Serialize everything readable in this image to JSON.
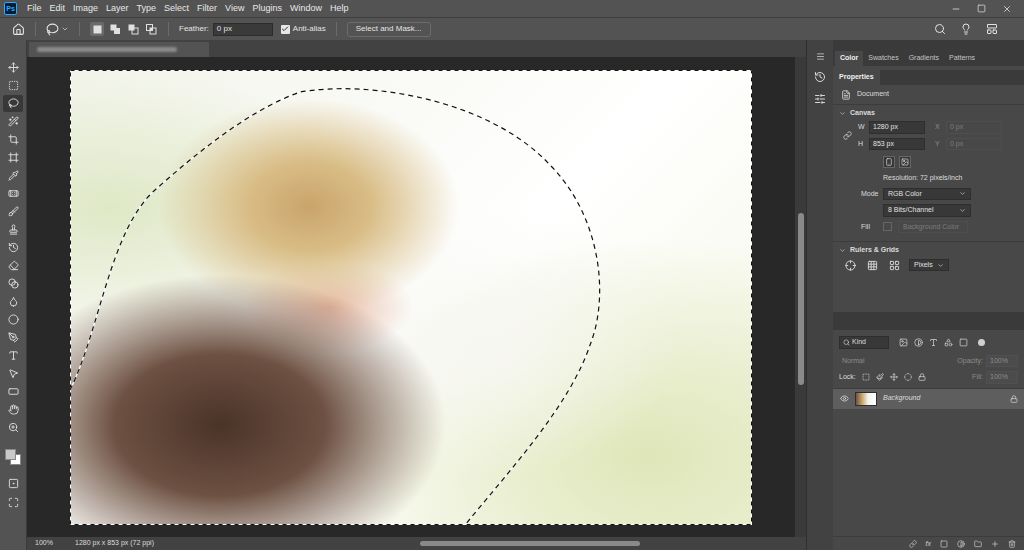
{
  "app": {
    "logo": "Ps"
  },
  "menu": [
    "File",
    "Edit",
    "Image",
    "Layer",
    "Type",
    "Select",
    "Filter",
    "View",
    "Plugins",
    "Window",
    "Help"
  ],
  "options_bar": {
    "feather_label": "Feather:",
    "feather_value": "0 px",
    "anti_alias": {
      "label": "Anti-alias",
      "checked": true
    },
    "select_and_mask": "Select and Mask...",
    "modes": [
      {
        "selected": true
      },
      {
        "selected": false
      },
      {
        "selected": false
      },
      {
        "selected": false
      }
    ]
  },
  "tools": [
    {
      "selected": false
    },
    {
      "selected": false
    },
    {
      "selected": true
    },
    {
      "selected": false
    },
    {
      "selected": false
    },
    {
      "selected": false
    },
    {
      "selected": false
    },
    {
      "selected": false
    },
    {
      "selected": false
    },
    {
      "selected": false
    },
    {
      "selected": false
    },
    {
      "selected": false
    },
    {
      "selected": false
    },
    {
      "selected": false
    },
    {
      "selected": false
    },
    {
      "selected": false
    },
    {
      "selected": false
    },
    {
      "selected": false
    },
    {
      "selected": false
    },
    {
      "selected": false
    },
    {
      "selected": false
    }
  ],
  "panel_tabs": [
    {
      "label": "Color",
      "selected": true
    },
    {
      "label": "Swatches",
      "selected": false
    },
    {
      "label": "Gradients",
      "selected": false
    },
    {
      "label": "Patterns",
      "selected": false
    }
  ],
  "properties": {
    "tab": "Properties",
    "target": "Document",
    "canvas": {
      "title": "Canvas",
      "fields": [
        {
          "label": "W",
          "value": "1280 px",
          "disabled": false
        },
        {
          "label": "X",
          "value": "0 px",
          "disabled": true
        },
        {
          "label": "H",
          "value": "853 px",
          "disabled": false
        },
        {
          "label": "Y",
          "value": "0 px",
          "disabled": true
        }
      ],
      "resolution": "Resolution: 72 pixels/inch",
      "mode_label": "Mode",
      "mode": "RGB Color",
      "depth": "8 Bits/Channel",
      "fill_label": "Fill",
      "fill": "Background Color",
      "fill_disabled": true
    },
    "rulers": {
      "title": "Rulers & Grids",
      "unit": "Pixels"
    }
  },
  "layers": {
    "filter": "Kind",
    "blend_mode": "Normal",
    "opacity_label": "Opacity:",
    "opacity": "100%",
    "lock_label": "Lock:",
    "fill_label": "Fill:",
    "fill": "100%",
    "controls_disabled": true,
    "items": [
      {
        "name": "Background",
        "visible": true,
        "locked": true,
        "selected": true
      }
    ],
    "footer": {
      "fx": "fx"
    }
  },
  "status_bar": {
    "zoom": "100%",
    "info": "1280 px x 853 px (72 ppi)"
  }
}
